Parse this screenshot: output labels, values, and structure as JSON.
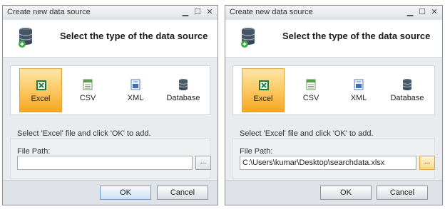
{
  "left": {
    "title": "Create new data source",
    "heading": "Select the type of the data source",
    "types": [
      {
        "label": "Excel",
        "icon": "excel-icon"
      },
      {
        "label": "CSV",
        "icon": "csv-icon"
      },
      {
        "label": "XML",
        "icon": "xml-icon"
      },
      {
        "label": "Database",
        "icon": "database-icon"
      }
    ],
    "selected_type": "Excel",
    "instruction": "Select 'Excel' file and click 'OK' to add.",
    "path_label": "File Path:",
    "path_value": "",
    "browse_label": "...",
    "ok_label": "OK",
    "cancel_label": "Cancel"
  },
  "right": {
    "title": "Create new data source",
    "heading": "Select the type of the data source",
    "types": [
      {
        "label": "Excel",
        "icon": "excel-icon"
      },
      {
        "label": "CSV",
        "icon": "csv-icon"
      },
      {
        "label": "XML",
        "icon": "xml-icon"
      },
      {
        "label": "Database",
        "icon": "database-icon"
      }
    ],
    "selected_type": "Excel",
    "instruction": "Select 'Excel' file and click 'OK' to add.",
    "path_label": "File Path:",
    "path_value": "C:\\Users\\kumar\\Desktop\\searchdata.xlsx",
    "browse_label": "...",
    "ok_label": "OK",
    "cancel_label": "Cancel"
  },
  "colors": {
    "selected_tile": "#fbc55c",
    "accent_blue": "#6f97c7",
    "excel_green": "#1f7a3a"
  }
}
